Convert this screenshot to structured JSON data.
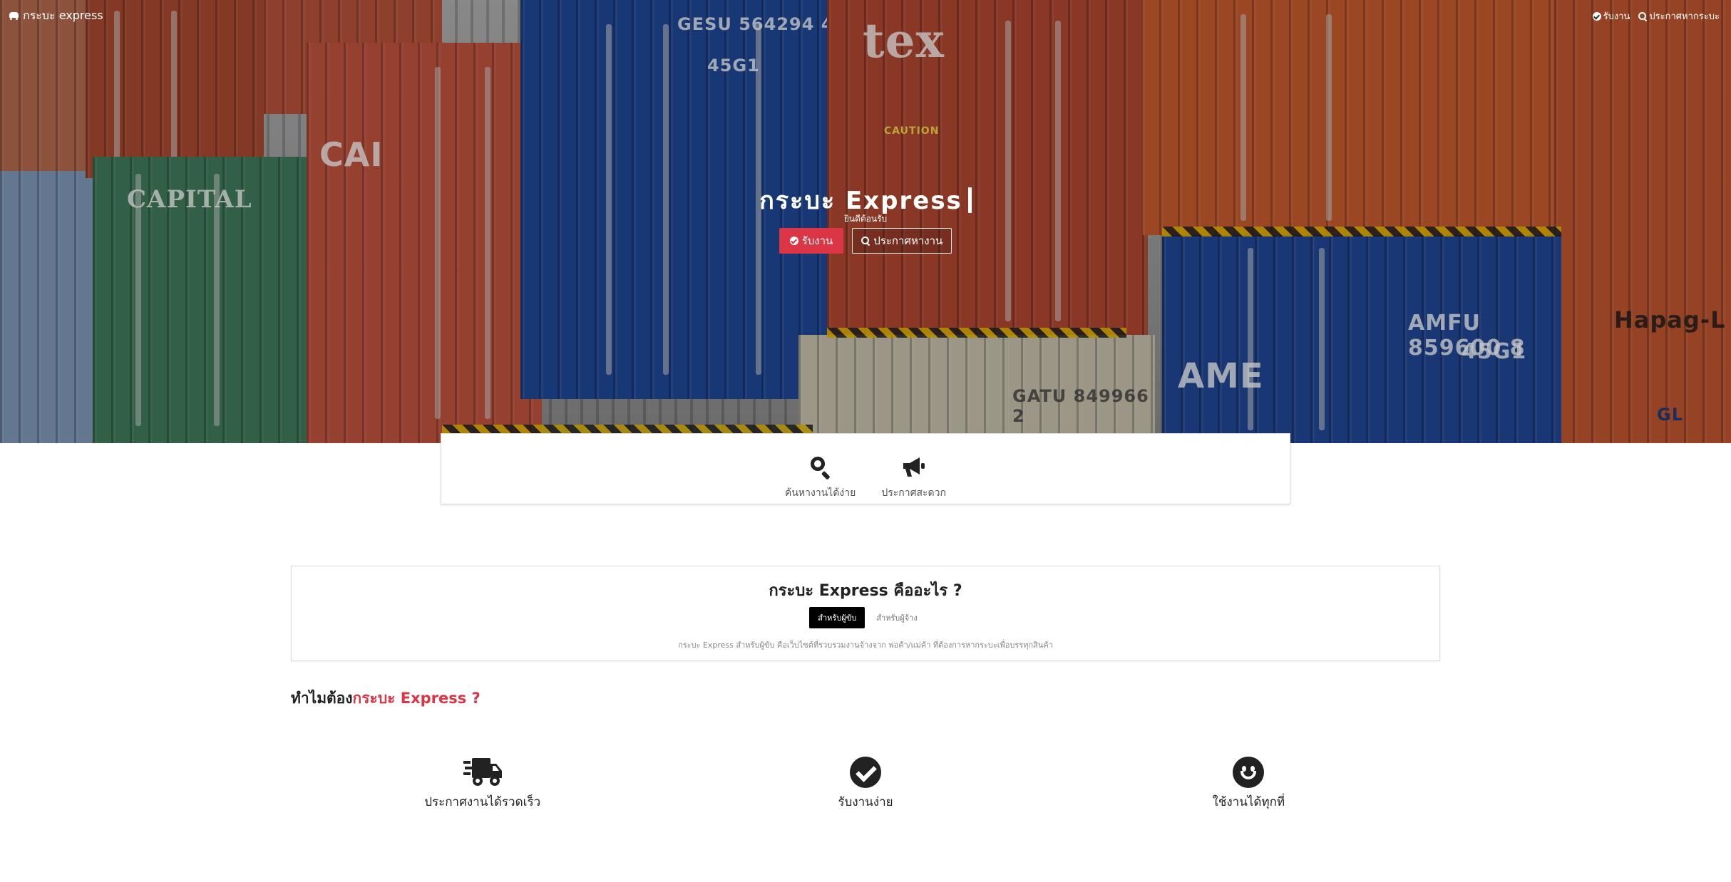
{
  "navbar": {
    "brand": "กระบะ express",
    "links": [
      {
        "label": "รับงาน",
        "icon": "check-circle-icon"
      },
      {
        "label": "ประกาศหากระบะ",
        "icon": "search-icon"
      }
    ]
  },
  "hero": {
    "title": "กระบะ Express",
    "subtitle": "ยินดีต้อนรับ",
    "buttons": [
      {
        "label": "รับงาน",
        "icon": "check-circle-icon"
      },
      {
        "label": "ประกาศหางาน",
        "icon": "search-icon"
      }
    ],
    "container_stencils": [
      "CAPITAL",
      "CAI",
      "GESU 564294 4",
      "45G1",
      "tex",
      "CAUTION",
      "AMFU 859600 8",
      "45G1",
      "GATU 849966 2",
      "Hapag-L",
      "AME",
      "GL"
    ]
  },
  "features": [
    {
      "label": "ค้นหางานได้ง่าย",
      "icon": "search-icon"
    },
    {
      "label": "ประกาศสะดวก",
      "icon": "megaphone-icon"
    }
  ],
  "what_is": {
    "title": "กระบะ Express คืออะไร ?",
    "tabs": [
      {
        "label": "สำหรับผู้ขับ",
        "active": true
      },
      {
        "label": "สำหรับผู้จ้าง",
        "active": false
      }
    ],
    "description": "กระบะ Express สำหรับผู้ขับ คือเว็บไซต์ที่รวบรวมงานจ้างจาก พ่อค้า/แม่ค้า ที่ต้องการหากระบะเพื่อบรรทุกสินค้า"
  },
  "why": {
    "title_prefix": "ทำไมต้อง",
    "title_highlight": "กระบะ Express ?",
    "items": [
      {
        "label": "ประกาศงานได้รวดเร็ว",
        "icon": "truck-fast-icon"
      },
      {
        "label": "รับงานง่าย",
        "icon": "check-circle-icon"
      },
      {
        "label": "ใช้งานได้ทุกที่",
        "icon": "smile-icon"
      }
    ]
  },
  "colors": {
    "accent_red": "#dc3545",
    "dark": "#222222",
    "tab_active_bg": "#000000"
  }
}
